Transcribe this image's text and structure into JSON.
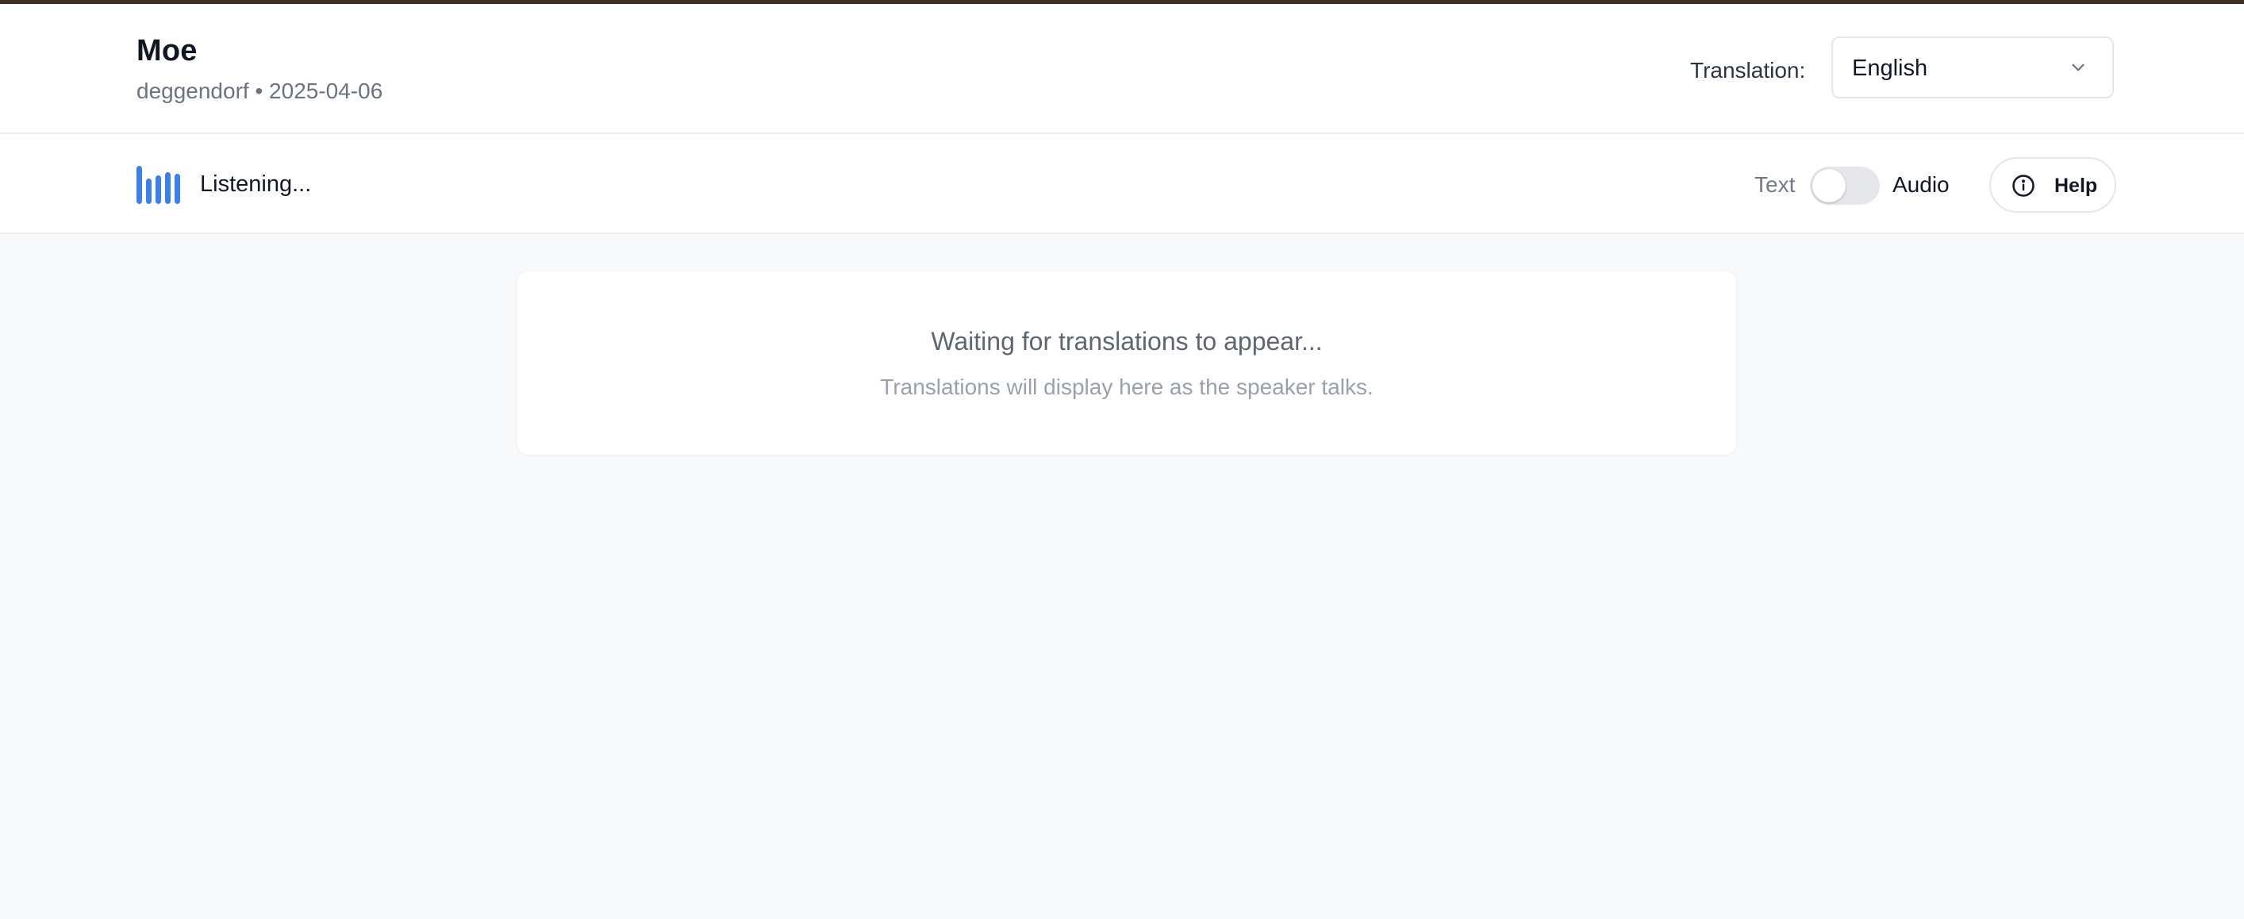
{
  "header": {
    "title": "Moe",
    "meta": "deggendorf • 2025-04-06",
    "translation_label": "Translation:",
    "selected_language": "English"
  },
  "status": {
    "listening_label": "Listening...",
    "mode_text_label": "Text",
    "mode_audio_label": "Audio",
    "audio_mode_enabled": false,
    "help_label": "Help"
  },
  "content": {
    "waiting_title": "Waiting for translations to appear...",
    "waiting_subtitle": "Translations will display here as the speaker talks."
  },
  "icons": {
    "language_dropdown": "chevron-down-icon",
    "listening_indicator": "audio-wave-icon",
    "help": "info-icon"
  },
  "colors": {
    "accent": "#3b7ff0",
    "top_strip": "#3f3126",
    "page_background": "#f8f9fb"
  }
}
